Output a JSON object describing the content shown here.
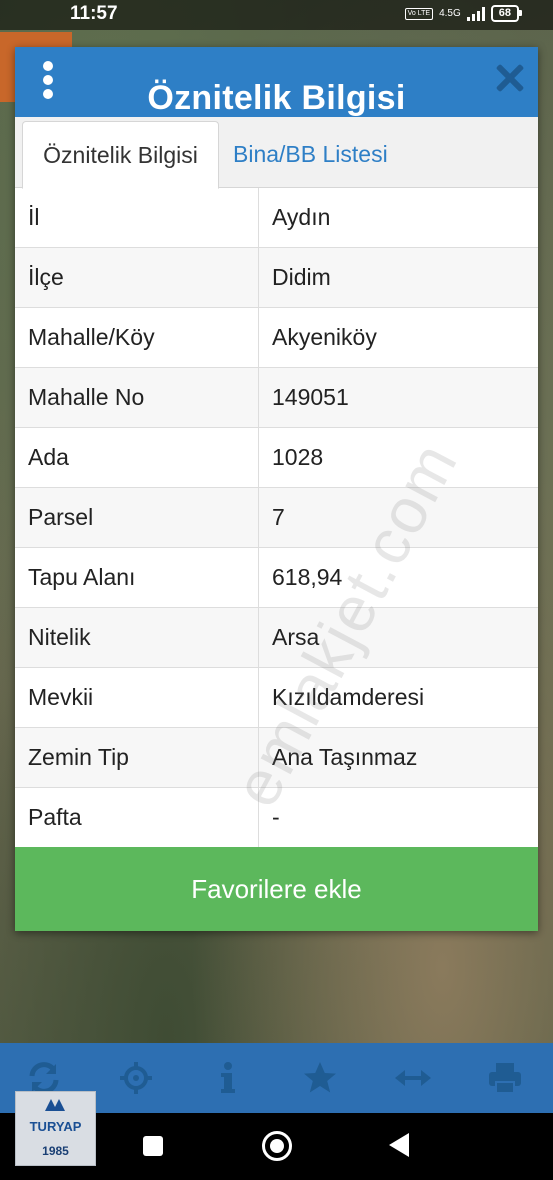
{
  "status_bar": {
    "time": "11:57",
    "network": "4.5G",
    "volte": "Vo LTE",
    "battery": "68"
  },
  "dialog": {
    "title": "Öznitelik Bilgisi",
    "tabs": [
      {
        "label": "Öznitelik Bilgisi",
        "active": true
      },
      {
        "label": "Bina/BB Listesi",
        "active": false
      }
    ],
    "rows": [
      {
        "key": "İl",
        "value": "Aydın"
      },
      {
        "key": "İlçe",
        "value": "Didim"
      },
      {
        "key": "Mahalle/Köy",
        "value": "Akyeniköy"
      },
      {
        "key": "Mahalle No",
        "value": "149051"
      },
      {
        "key": "Ada",
        "value": "1028"
      },
      {
        "key": "Parsel",
        "value": "7"
      },
      {
        "key": "Tapu Alanı",
        "value": "618,94"
      },
      {
        "key": "Nitelik",
        "value": "Arsa"
      },
      {
        "key": "Mevkii",
        "value": "Kızıldamderesi"
      },
      {
        "key": "Zemin Tip",
        "value": "Ana Taşınmaz"
      },
      {
        "key": "Pafta",
        "value": "-"
      }
    ],
    "favorite_button": "Favorilere ekle"
  },
  "watermark": "emlakjet.com",
  "toolbar": {
    "icons": [
      "refresh-icon",
      "crosshair-icon",
      "info-icon",
      "star-icon",
      "measure-icon",
      "print-icon"
    ]
  },
  "logo": {
    "name": "TURYAP",
    "year": "1985"
  },
  "colors": {
    "header": "#2e7fc6",
    "close": "#1f5c93",
    "favorite": "#5cb85c",
    "toolbar": "#2d6fb2"
  }
}
